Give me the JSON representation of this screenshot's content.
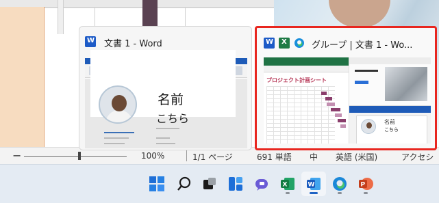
{
  "background": {
    "status_bar": {
      "zoom_minus": "−",
      "zoom_percent": "100%",
      "page_info": "1/1 ページ",
      "word_count": "691 単語",
      "input_mode": "中",
      "language": "英語 (米国)",
      "accessibility": "アクセシ"
    }
  },
  "previews": [
    {
      "title": "文書 1 - Word",
      "apps": [
        "word-icon"
      ],
      "content": {
        "name": "名前",
        "sub": "こちら"
      }
    },
    {
      "title": "グループ | 文書 1 - Wo...",
      "apps": [
        "word-icon",
        "excel-icon",
        "edge-icon"
      ],
      "selected": true,
      "content": {
        "excel_title": "プロジェクト計画シート",
        "word_name": "名前",
        "word_sub": "こちら"
      }
    }
  ],
  "taskbar": {
    "items": [
      {
        "icon": "windows-start-icon",
        "indicator": false
      },
      {
        "icon": "search-icon",
        "indicator": false
      },
      {
        "icon": "task-view-icon",
        "indicator": false
      },
      {
        "icon": "widgets-icon",
        "indicator": false
      },
      {
        "icon": "teams-chat-icon",
        "indicator": false
      },
      {
        "icon": "excel-icon",
        "indicator": true
      },
      {
        "icon": "word-icon",
        "indicator": true,
        "active": true
      },
      {
        "icon": "edge-icon",
        "indicator": true
      },
      {
        "icon": "powerpoint-icon",
        "indicator": true
      }
    ]
  },
  "colors": {
    "selection_border": "#e8261f",
    "word_blue": "#1d5bc7",
    "excel_green": "#1f7a45",
    "powerpoint_orange": "#d24726",
    "taskbar_bg": "#e4ebf3"
  }
}
